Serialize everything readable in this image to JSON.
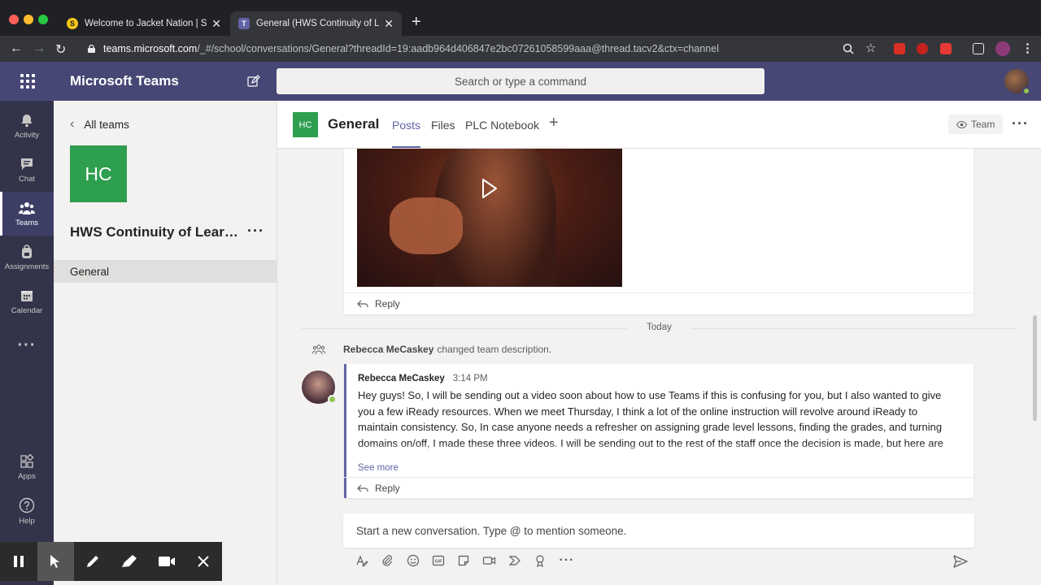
{
  "browser": {
    "tabs": [
      {
        "title": "Welcome to Jacket Nation | Star",
        "favicon": "s-favicon-icon"
      },
      {
        "title": "General (HWS Continuity of Lea",
        "favicon": "teams-favicon-icon",
        "active": true
      }
    ],
    "url_host": "teams.microsoft.com",
    "url_path": "/_#/school/conversations/General?threadId=19:aadb964d406847e2bc07261058599aaa@thread.tacv2&ctx=channel"
  },
  "teams": {
    "app_title": "Microsoft Teams",
    "search_placeholder": "Search or type a command"
  },
  "rail": {
    "items": [
      {
        "label": "Activity",
        "icon": "bell-icon"
      },
      {
        "label": "Chat",
        "icon": "chat-icon"
      },
      {
        "label": "Teams",
        "icon": "teams-icon",
        "active": true
      },
      {
        "label": "Assignments",
        "icon": "backpack-icon"
      },
      {
        "label": "Calendar",
        "icon": "calendar-icon"
      },
      {
        "label": "Apps",
        "icon": "apps-icon"
      },
      {
        "label": "Help",
        "icon": "help-icon"
      }
    ]
  },
  "team_panel": {
    "back_label": "All teams",
    "tile_initials": "HC",
    "team_name": "HWS Continuity of Learning",
    "channels": [
      "General"
    ]
  },
  "channel": {
    "tile_initials": "HC",
    "name": "General",
    "tabs": [
      "Posts",
      "Files",
      "PLC Notebook"
    ],
    "active_tab": "Posts",
    "team_button": "Team"
  },
  "conversation": {
    "reply_label": "Reply",
    "date_divider": "Today",
    "system_message": {
      "author": "Rebecca MeCaskey",
      "text": "changed team description."
    },
    "post": {
      "author": "Rebecca MeCaskey",
      "time": "3:14 PM",
      "body": "Hey guys! So, I will be sending out a video soon about how to use Teams if this is confusing for you, but I also wanted to give you a few iReady resources. When we meet Thursday, I think a lot of the online instruction will revolve around iReady to maintain consistency. So, In case anyone needs a refresher on assigning grade level lessons, finding the grades, and turning domains on/off, I made these three videos. I will be sending out to the rest of the staff once the decision is made, but here are the links:",
      "see_more": "See more"
    },
    "new_conversation_placeholder": "Start a new conversation. Type @ to mention someone."
  },
  "colors": {
    "teams_purple": "#6264a7",
    "header_bg": "#464775",
    "rail_bg": "#33344a",
    "team_tile": "#2e9e4f",
    "presence_available": "#92c353"
  }
}
